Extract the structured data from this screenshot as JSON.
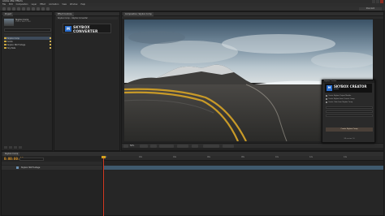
{
  "window": {
    "title": "Adobe After Effects"
  },
  "menu": [
    "File",
    "Edit",
    "Composition",
    "Layer",
    "Effect",
    "Animation",
    "View",
    "Window",
    "Help"
  ],
  "workspace": "Standard",
  "project": {
    "tab": "Project",
    "name": "Skybox Comp",
    "details": "1920 x 960 (1.00)",
    "files": [
      {
        "name": "Skybox Comp",
        "selected": true
      },
      {
        "name": "Solids",
        "selected": false
      },
      {
        "name": "Skybox 360 Footage",
        "selected": false
      },
      {
        "name": "Sky Plate",
        "selected": false
      }
    ]
  },
  "effects": {
    "tab": "Effect Controls",
    "row": "Skybox Comp • Skybox Converter",
    "logo": {
      "mark": "M",
      "name": "SKYBOX CONVERTER",
      "sub": "mettle"
    }
  },
  "comp": {
    "tab": "Composition: Skybox Comp",
    "zoom": "50%",
    "timecode": "0:00:00:00",
    "colors": {
      "sky_top": "#3f5b73",
      "sky_mid": "#9fb4c2",
      "ground": "#3b3a36",
      "road_line": "#c89a28"
    }
  },
  "skybox_window": {
    "title": "Skybox Creator",
    "logo": {
      "mark": "M",
      "name": "SKYBOX CREATOR",
      "sub": "mettle"
    },
    "options": [
      {
        "label": "Create Skybox Output Module",
        "checked": true
      },
      {
        "label": "Create Skybox from Current Comp",
        "checked": true
      },
      {
        "label": "Create Cube from Skybox Comp",
        "checked": false
      }
    ],
    "button": "Create Skybox Comp",
    "footer": "VR version 1.0"
  },
  "timeline": {
    "tab": "Skybox Comp",
    "timecode": "0:00:00:00",
    "ruler": [
      "0s",
      "02s",
      "04s",
      "06s",
      "08s",
      "10s",
      "12s",
      "14s"
    ],
    "layer": "Skybox 360 Footage"
  }
}
